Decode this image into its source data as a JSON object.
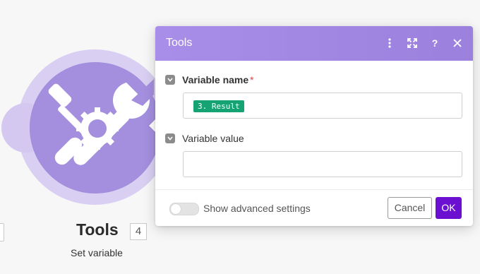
{
  "module": {
    "title": "Tools",
    "count": "4",
    "subtitle": "Set variable",
    "icon": "tools-icon"
  },
  "dialog": {
    "title": "Tools",
    "header_icons": [
      "more-vertical-icon",
      "expand-icon",
      "help-icon",
      "close-icon"
    ],
    "fields": [
      {
        "label": "Variable name",
        "required_mark": "*",
        "value_pill": "3. Result"
      },
      {
        "label": "Variable value",
        "value": ""
      }
    ],
    "advanced_label": "Show advanced settings",
    "cancel_label": "Cancel",
    "ok_label": "OK"
  },
  "colors": {
    "accent": "#6b0fd1",
    "header": "#a88ee8",
    "module": "#a48fdf",
    "pill": "#16a374"
  }
}
